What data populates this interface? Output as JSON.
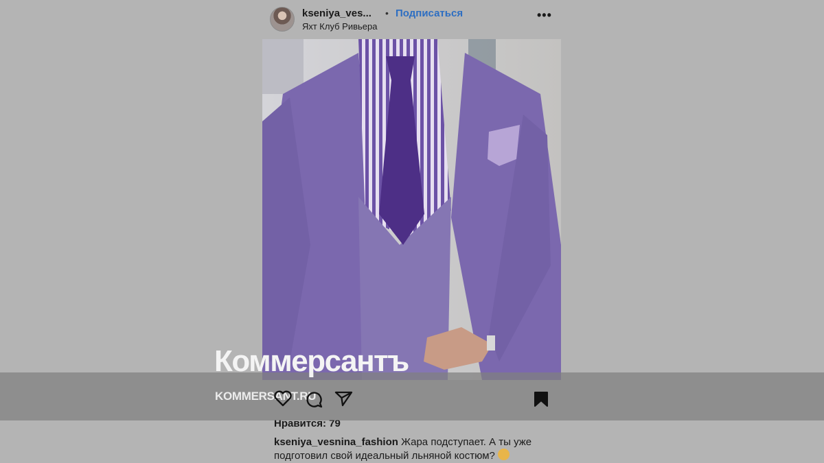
{
  "post": {
    "username": "kseniya_ves...",
    "dot": "•",
    "follow_label": "Подписаться",
    "location": "Яхт Клуб Ривьера",
    "more": "•••"
  },
  "watermark": {
    "brand": "Коммерсантъ",
    "site": "KOMMERSANT.RU"
  },
  "icons": {
    "like": "heart-icon",
    "comment": "comment-icon",
    "share": "send-icon",
    "save": "bookmark-icon"
  },
  "likes_text": "Нравится: 79",
  "caption": {
    "user": "kseniya_vesnina_fashion",
    "text": " Жара подступает. А ты уже подготовил свой идеальный льняной костюм?"
  },
  "colors": {
    "background": "#b4b4b4",
    "accent_link": "#2d6ec2",
    "suit": "#7b68ae",
    "tie": "#4d2f86"
  }
}
